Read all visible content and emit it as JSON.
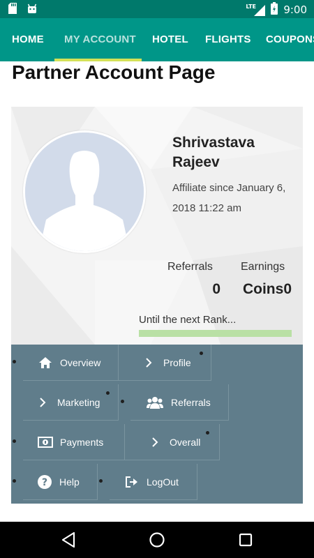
{
  "status_bar": {
    "network_label": "LTE",
    "time": "9:00",
    "icons": [
      "sd-card-icon",
      "android-icon",
      "signal-icon",
      "battery-icon"
    ]
  },
  "tabs": [
    {
      "label": "HOME",
      "active": false
    },
    {
      "label": "MY ACCOUNT",
      "active": true
    },
    {
      "label": "HOTEL",
      "active": false
    },
    {
      "label": "FLIGHTS",
      "active": false
    },
    {
      "label": "COUPONS",
      "active": false
    }
  ],
  "page": {
    "title": "Partner Account Page"
  },
  "profile": {
    "name": "Shrivastava Rajeev",
    "affiliate_since": "Affiliate since January 6, 2018 11:22 am",
    "avatar_icon": "avatar-placeholder-icon",
    "stats": {
      "referrals_label": "Referrals",
      "referrals_value": "0",
      "earnings_label": "Earnings",
      "earnings_value": "Coins0"
    },
    "rank": {
      "label": "Until the next Rank...",
      "progress": 1.0
    }
  },
  "menu": {
    "overview": {
      "label": "Overview",
      "icon": "home-icon"
    },
    "profile": {
      "label": "Profile",
      "icon": "chevron-right-icon"
    },
    "marketing": {
      "label": "Marketing",
      "icon": "chevron-right-icon"
    },
    "referrals": {
      "label": "Referrals",
      "icon": "group-icon"
    },
    "payments": {
      "label": "Payments",
      "icon": "money-icon"
    },
    "overall": {
      "label": "Overall",
      "icon": "chevron-right-icon"
    },
    "help": {
      "label": "Help",
      "icon": "help-icon"
    },
    "logout": {
      "label": "LogOut",
      "icon": "logout-icon"
    }
  },
  "nav_bar": {
    "icons": [
      "back-icon",
      "home-circle-icon",
      "recents-icon"
    ]
  },
  "colors": {
    "status_bar": "#00796b",
    "tab_bar": "#009688",
    "tab_indicator": "#d4e157",
    "menu_panel": "#607d8b",
    "rank_bar": "#b9e0a5"
  }
}
